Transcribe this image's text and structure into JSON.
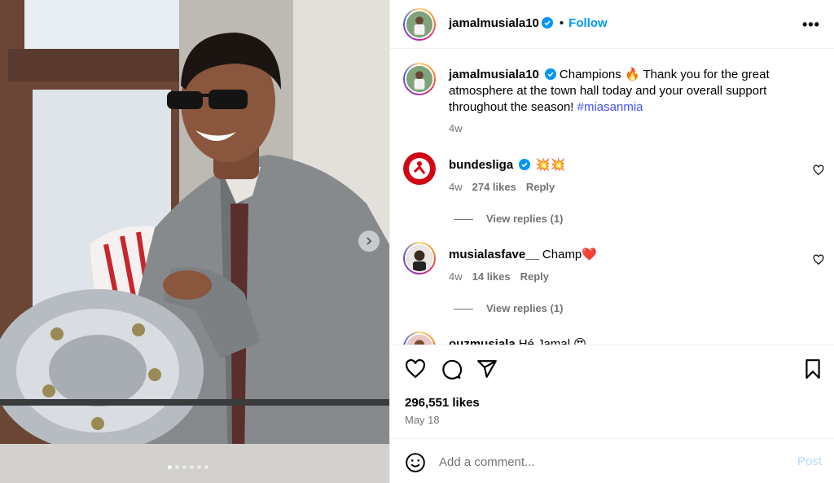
{
  "post": {
    "author": "jamalmusiala10",
    "follow_label": "Follow",
    "separator": "•",
    "more_label": "•••",
    "caption_prefix": "Champions 🔥 Thank you for the great atmosphere at the town hall today and your overall support throughout the season!",
    "hashtag": "#miasanmia",
    "caption_time": "4w",
    "likes": "296,551 likes",
    "date": "May 18",
    "carousel_count": 6,
    "carousel_active_index": 0
  },
  "comments": [
    {
      "user": "bundesliga",
      "verified": true,
      "text": "💥💥",
      "time": "4w",
      "likes": "274 likes",
      "reply": "Reply",
      "view_replies": "View replies (1)"
    },
    {
      "user": "musialasfave__",
      "verified": false,
      "text": "Champ❤️",
      "time": "4w",
      "likes": "14 likes",
      "reply": "Reply",
      "view_replies": "View replies (1)"
    },
    {
      "user": "ouzmusiala",
      "verified": false,
      "text": "Hé Jamal 😍"
    }
  ],
  "composer": {
    "placeholder": "Add a comment...",
    "post_label": "Post"
  },
  "icons": {
    "verified": "verified-badge-icon",
    "like": "heart-icon",
    "comment": "comment-icon",
    "share": "share-icon",
    "save": "bookmark-icon",
    "emoji": "emoji-icon",
    "more": "more-options-icon",
    "next": "chevron-right-icon"
  },
  "colors": {
    "accent": "#0095f6",
    "hashtag": "#4150f7",
    "muted": "#737373",
    "verified": "#0095f6",
    "post_disabled": "#b3dbff"
  }
}
